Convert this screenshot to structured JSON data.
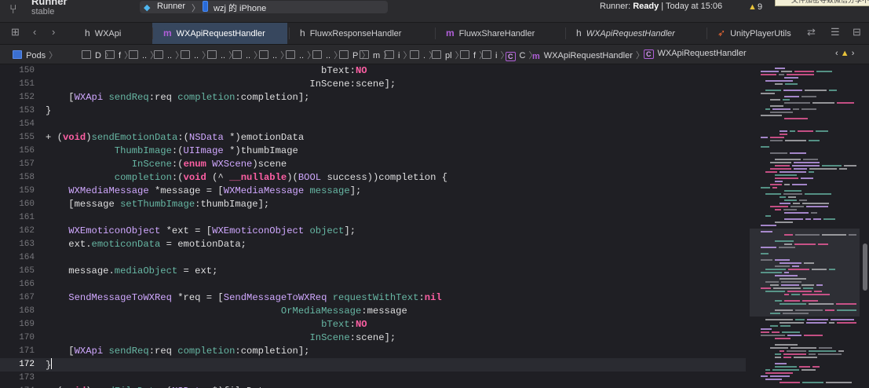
{
  "title": {
    "project": "Runner",
    "sub": "stable",
    "scheme": "Runner",
    "separator": "〉",
    "device": "wzj 的 iPhone",
    "status_prefix": "Runner: ",
    "status_bold": "Ready",
    "status_suffix": " | Today at 15:06",
    "warning_count": "9",
    "tooltip": "文件加密导致微信分享不"
  },
  "tabs": [
    {
      "icon": "h",
      "label": "WXApi",
      "active": false,
      "italic": false
    },
    {
      "icon": "m",
      "label": "WXApiRequestHandler",
      "active": true,
      "italic": false
    },
    {
      "icon": "h",
      "label": "FluwxResponseHandler",
      "active": false,
      "italic": false
    },
    {
      "icon": "m",
      "label": "FluwxShareHandler",
      "active": false,
      "italic": false
    },
    {
      "icon": "h",
      "label": "WXApiRequestHandler",
      "active": false,
      "italic": true
    },
    {
      "icon": "swift",
      "label": "UnityPlayerUtils",
      "active": false,
      "italic": false
    }
  ],
  "jumpbar": [
    "Pods",
    "D",
    "f",
    "..",
    "..",
    "..",
    "..",
    "..",
    "..",
    "..",
    "..",
    "P",
    "m",
    "i",
    ".",
    "pl",
    "f",
    "i",
    "C",
    "WXApiRequestHandler",
    "WXApiRequestHandler"
  ],
  "code_lines": [
    {
      "n": "150",
      "segs": [
        [
          "",
          "                                                bText"
        ],
        [
          "s",
          ":"
        ],
        [
          "k",
          "NO"
        ]
      ]
    },
    {
      "n": "151",
      "segs": [
        [
          "",
          "                                              InScene"
        ],
        [
          "s",
          ":scene];"
        ]
      ]
    },
    {
      "n": "152",
      "segs": [
        [
          "s",
          "    ["
        ],
        [
          "t",
          "WXApi"
        ],
        [
          "s",
          " "
        ],
        [
          "f",
          "sendReq"
        ],
        [
          "s",
          ":req "
        ],
        [
          "f",
          "completion"
        ],
        [
          "s",
          ":completion];"
        ]
      ]
    },
    {
      "n": "153",
      "segs": [
        [
          "s",
          "}"
        ]
      ]
    },
    {
      "n": "154",
      "segs": [
        [
          "s",
          ""
        ]
      ]
    },
    {
      "n": "155",
      "segs": [
        [
          "s",
          "+ ("
        ],
        [
          "k",
          "void"
        ],
        [
          "s",
          ")"
        ],
        [
          "f",
          "sendEmotionData"
        ],
        [
          "s",
          ":("
        ],
        [
          "t",
          "NSData"
        ],
        [
          "s",
          " *)emotionData"
        ]
      ]
    },
    {
      "n": "156",
      "segs": [
        [
          "s",
          "            "
        ],
        [
          "f",
          "ThumbImage"
        ],
        [
          "s",
          ":("
        ],
        [
          "t",
          "UIImage"
        ],
        [
          "s",
          " *)thumbImage"
        ]
      ]
    },
    {
      "n": "157",
      "segs": [
        [
          "s",
          "               "
        ],
        [
          "f",
          "InScene"
        ],
        [
          "s",
          ":("
        ],
        [
          "k",
          "enum"
        ],
        [
          "s",
          " "
        ],
        [
          "t",
          "WXScene"
        ],
        [
          "s",
          ")scene"
        ]
      ]
    },
    {
      "n": "158",
      "segs": [
        [
          "s",
          "            "
        ],
        [
          "f",
          "completion"
        ],
        [
          "s",
          ":("
        ],
        [
          "k",
          "void"
        ],
        [
          "s",
          " (^ "
        ],
        [
          "k",
          "__nullable"
        ],
        [
          "s",
          ")("
        ],
        [
          "t",
          "BOOL"
        ],
        [
          "s",
          " success))completion {"
        ]
      ]
    },
    {
      "n": "159",
      "segs": [
        [
          "s",
          "    "
        ],
        [
          "t",
          "WXMediaMessage"
        ],
        [
          "s",
          " *message = ["
        ],
        [
          "t",
          "WXMediaMessage"
        ],
        [
          "s",
          " "
        ],
        [
          "f",
          "message"
        ],
        [
          "s",
          "];"
        ]
      ]
    },
    {
      "n": "160",
      "segs": [
        [
          "s",
          "    [message "
        ],
        [
          "f",
          "setThumbImage"
        ],
        [
          "s",
          ":thumbImage];"
        ]
      ]
    },
    {
      "n": "161",
      "segs": [
        [
          "s",
          ""
        ]
      ]
    },
    {
      "n": "162",
      "segs": [
        [
          "s",
          "    "
        ],
        [
          "t",
          "WXEmoticonObject"
        ],
        [
          "s",
          " *ext = ["
        ],
        [
          "t",
          "WXEmoticonObject"
        ],
        [
          "s",
          " "
        ],
        [
          "f",
          "object"
        ],
        [
          "s",
          "];"
        ]
      ]
    },
    {
      "n": "163",
      "segs": [
        [
          "s",
          "    ext."
        ],
        [
          "f",
          "emoticonData"
        ],
        [
          "s",
          " = emotionData;"
        ]
      ]
    },
    {
      "n": "164",
      "segs": [
        [
          "s",
          ""
        ]
      ]
    },
    {
      "n": "165",
      "segs": [
        [
          "s",
          "    message."
        ],
        [
          "f",
          "mediaObject"
        ],
        [
          "s",
          " = ext;"
        ]
      ]
    },
    {
      "n": "166",
      "segs": [
        [
          "s",
          ""
        ]
      ]
    },
    {
      "n": "167",
      "segs": [
        [
          "s",
          "    "
        ],
        [
          "t",
          "SendMessageToWXReq"
        ],
        [
          "s",
          " *req = ["
        ],
        [
          "t",
          "SendMessageToWXReq"
        ],
        [
          "s",
          " "
        ],
        [
          "f",
          "requestWithText"
        ],
        [
          "s",
          ":"
        ],
        [
          "k",
          "nil"
        ]
      ]
    },
    {
      "n": "168",
      "segs": [
        [
          "s",
          "                                         "
        ],
        [
          "f",
          "OrMediaMessage"
        ],
        [
          "s",
          ":message"
        ]
      ]
    },
    {
      "n": "169",
      "segs": [
        [
          "s",
          "                                                "
        ],
        [
          "f",
          "bText"
        ],
        [
          "s",
          ":"
        ],
        [
          "k",
          "NO"
        ]
      ]
    },
    {
      "n": "170",
      "segs": [
        [
          "s",
          "                                              "
        ],
        [
          "f",
          "InScene"
        ],
        [
          "s",
          ":scene];"
        ]
      ]
    },
    {
      "n": "171",
      "segs": [
        [
          "s",
          "    ["
        ],
        [
          "t",
          "WXApi"
        ],
        [
          "s",
          " "
        ],
        [
          "f",
          "sendReq"
        ],
        [
          "s",
          ":req "
        ],
        [
          "f",
          "completion"
        ],
        [
          "s",
          ":completion];"
        ]
      ]
    },
    {
      "n": "172",
      "segs": [
        [
          "s",
          "}"
        ]
      ],
      "current": true
    },
    {
      "n": "173",
      "segs": [
        [
          "s",
          ""
        ]
      ]
    },
    {
      "n": "174",
      "segs": [
        [
          "s",
          "+ ("
        ],
        [
          "k",
          "void"
        ],
        [
          "s",
          ")"
        ],
        [
          "f",
          "sendFileData"
        ],
        [
          "s",
          ":("
        ],
        [
          "t",
          "NSData"
        ],
        [
          "s",
          " *)fileData"
        ]
      ]
    }
  ],
  "colors": {
    "keyword": "#fc5fa3",
    "type": "#d0a8ff",
    "function": "#67b7a4",
    "plain": "#dfdfe0",
    "active_tab": "#37475e"
  }
}
